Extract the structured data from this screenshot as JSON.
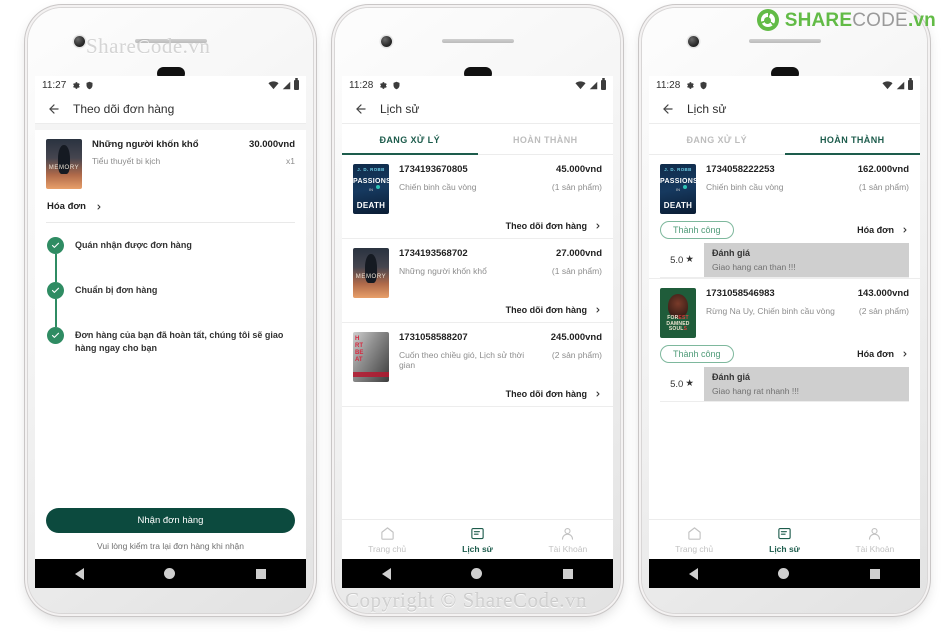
{
  "branding": {
    "logo_share": "SHARE",
    "logo_code": "CODE",
    "logo_tld": ".vn",
    "watermark_top": "ShareCode.vn",
    "watermark_bottom": "Copyright © ShareCode.vn"
  },
  "icons": {
    "back": "back-arrow-icon",
    "chevron": "chevron-right-icon",
    "gear": "gear-icon",
    "shield": "shield-icon",
    "wifi": "wifi-icon",
    "signal": "signal-icon",
    "battery": "battery-icon",
    "check": "check-icon",
    "star": "★",
    "home": "home-icon",
    "history": "history-icon",
    "account": "account-icon"
  },
  "colors": {
    "accent": "#1d5c4c",
    "button": "#0c4a3e",
    "timeline_dot": "#2f8c63",
    "badge_border": "#7eb89d",
    "badge_text": "#4f9b78",
    "star": "#fcd303",
    "logo_green": "#62bb46",
    "logo_gray": "#9a9a9a"
  },
  "phone1": {
    "status": {
      "time": "11:27"
    },
    "appbar": {
      "title": "Theo dõi đơn hàng"
    },
    "product": {
      "name": "Những người khốn khổ",
      "category": "Tiểu thuyết bi kịch",
      "price": "30.000vnd",
      "quantity": "x1",
      "cover": "memory"
    },
    "invoice_label": "Hóa đơn",
    "timeline": [
      {
        "text": "Quán nhận được đơn hàng"
      },
      {
        "text": "Chuẩn bị đơn hàng"
      },
      {
        "text": "Đơn hàng của bạn đã hoàn tất, chúng tôi sẽ giao hàng ngay cho bạn"
      }
    ],
    "cta_label": "Nhận đơn hàng",
    "cta_note": "Vui lòng kiểm tra lại đơn hàng khi nhận"
  },
  "phone2": {
    "status": {
      "time": "11:28"
    },
    "appbar": {
      "title": "Lịch sử"
    },
    "tabs": [
      {
        "label": "ĐANG XỬ LÝ",
        "active": true
      },
      {
        "label": "HOÀN THÀNH",
        "active": false
      }
    ],
    "orders": [
      {
        "id": "1734193670805",
        "books": "Chiến binh cầu vòng",
        "price": "45.000vnd",
        "count": "(1 sản phẩm)",
        "action": "Theo dõi đơn hàng",
        "cover": "passions"
      },
      {
        "id": "1734193568702",
        "books": "Những người khốn khổ",
        "price": "27.000vnd",
        "count": "(1 sản phẩm)",
        "action": "Theo dõi đơn hàng",
        "cover": "memory"
      },
      {
        "id": "1731058588207",
        "books": "Cuốn theo chiều gió, Lịch sử thời gian",
        "price": "245.000vnd",
        "count": "(2 sản phẩm)",
        "action": "Theo dõi đơn hàng",
        "cover": "heart"
      }
    ],
    "nav": [
      {
        "label": "Trang chủ",
        "icon": "home-icon",
        "active": false
      },
      {
        "label": "Lịch sử",
        "icon": "history-icon",
        "active": true
      },
      {
        "label": "Tài Khoản",
        "icon": "account-icon",
        "active": false
      }
    ]
  },
  "phone3": {
    "status": {
      "time": "11:28"
    },
    "appbar": {
      "title": "Lịch sử"
    },
    "tabs": [
      {
        "label": "ĐANG XỬ LÝ",
        "active": false
      },
      {
        "label": "HOÀN THÀNH",
        "active": true
      }
    ],
    "orders": [
      {
        "id": "1734058222253",
        "books": "Chiến binh cầu vòng",
        "price": "162.000vnd",
        "count": "(1 sản phẩm)",
        "badge": "Thành công",
        "action": "Hóa đơn",
        "cover": "passions",
        "review": {
          "score": "5.0",
          "title": "Đánh giá",
          "text": "Giao hang can than !!!"
        }
      },
      {
        "id": "1731058546983",
        "books": "Rừng Na Uy, Chiến binh cầu vòng",
        "price": "143.000vnd",
        "count": "(2 sản phẩm)",
        "badge": "Thành công",
        "action": "Hóa đơn",
        "cover": "forest",
        "review": {
          "score": "5.0",
          "title": "Đánh giá",
          "text": "Giao hang rat nhanh !!!"
        }
      }
    ],
    "nav": [
      {
        "label": "Trang chủ",
        "icon": "home-icon",
        "active": false
      },
      {
        "label": "Lịch sử",
        "icon": "history-icon",
        "active": true
      },
      {
        "label": "Tài Khoản",
        "icon": "account-icon",
        "active": false
      }
    ]
  }
}
